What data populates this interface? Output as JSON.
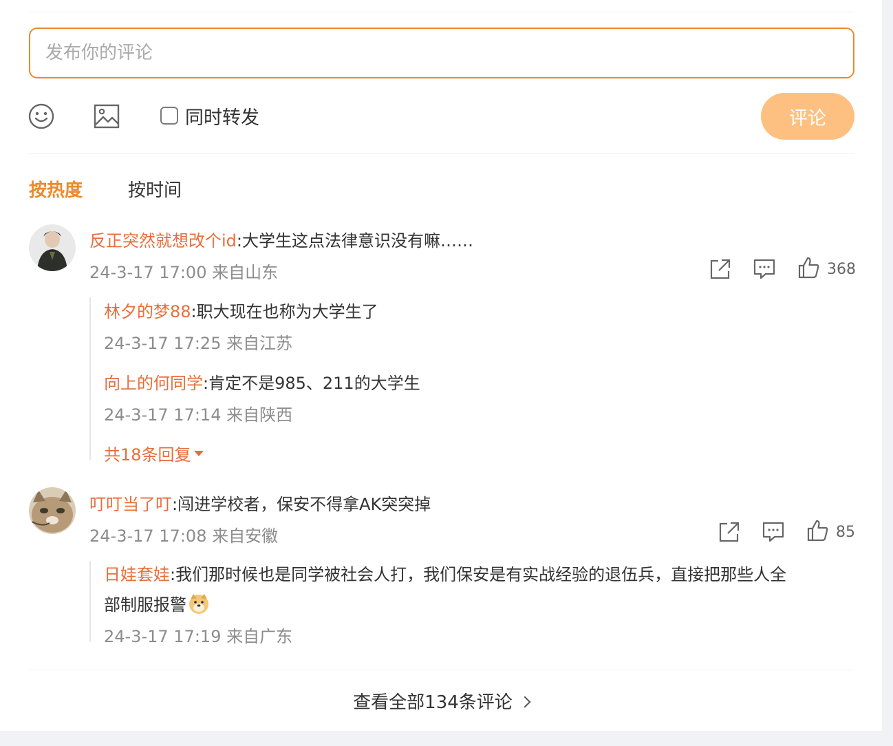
{
  "composer": {
    "placeholder": "发布你的评论",
    "repost_label": "同时转发",
    "submit_label": "评论",
    "accent_color": "#eb8a2b"
  },
  "tabs": [
    {
      "label": "按热度",
      "active": true
    },
    {
      "label": "按时间",
      "active": false
    }
  ],
  "comments": [
    {
      "user": "反正突然就想改个id",
      "text": ":大学生这点法律意识没有嘛……",
      "meta": "24-3-17 17:00 来自山东",
      "likes": "368",
      "replies": [
        {
          "user": "林夕的梦88",
          "text": ":职大现在也称为大学生了",
          "meta": "24-3-17 17:25 来自江苏"
        },
        {
          "user": "向上的何同学",
          "text": ":肯定不是985、211的大学生",
          "meta": "24-3-17 17:14 来自陕西"
        }
      ],
      "more_replies": "共18条回复"
    },
    {
      "user": "叮叮当了叮",
      "text": ":闯进学校者，保安不得拿AK突突掉",
      "meta": "24-3-17 17:08 来自安徽",
      "likes": "85",
      "replies": [
        {
          "user": "日娃套娃",
          "text_line1": ":我们那时候也是同学被社会人打，我们保安是有实战经验的退伍兵，直接把那些人全",
          "text_line2": "部制服报警",
          "meta": "24-3-17 17:19 来自广东"
        }
      ]
    }
  ],
  "footer": {
    "view_all": "查看全部134条评论"
  },
  "icons": [
    "emoji-icon",
    "image-icon",
    "share-icon",
    "comment-icon",
    "like-icon",
    "chevron-down-icon",
    "chevron-right-icon"
  ]
}
